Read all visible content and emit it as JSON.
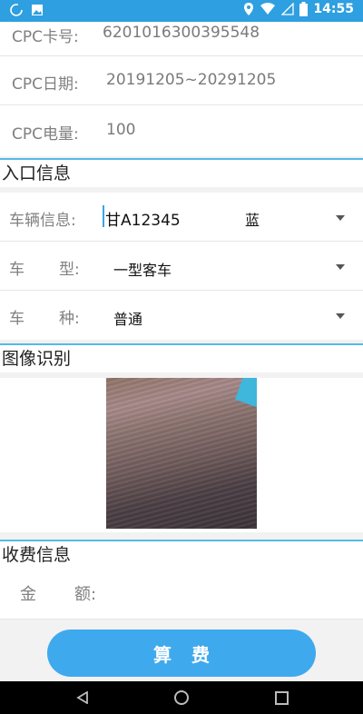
{
  "status_bar": {
    "time": "14:55"
  },
  "cpc": {
    "card_label": "CPC卡号:",
    "card_value": "6201016300395548",
    "date_label": "CPC日期:",
    "date_value": "20191205~20291205",
    "battery_label": "CPC电量:",
    "battery_value": "100"
  },
  "entry": {
    "title": "入口信息",
    "vehicle_label": "车辆信息:",
    "plate": "甘A12345",
    "plate_color": "蓝",
    "type_label_a": "车",
    "type_label_b": "型:",
    "type_value": "一型客车",
    "kind_label_a": "车",
    "kind_label_b": "种:",
    "kind_value": "普通"
  },
  "image": {
    "title": "图像识别"
  },
  "fee": {
    "title": "收费信息",
    "amount_label_a": "金",
    "amount_label_b": "额:",
    "calc_label": "算费"
  }
}
